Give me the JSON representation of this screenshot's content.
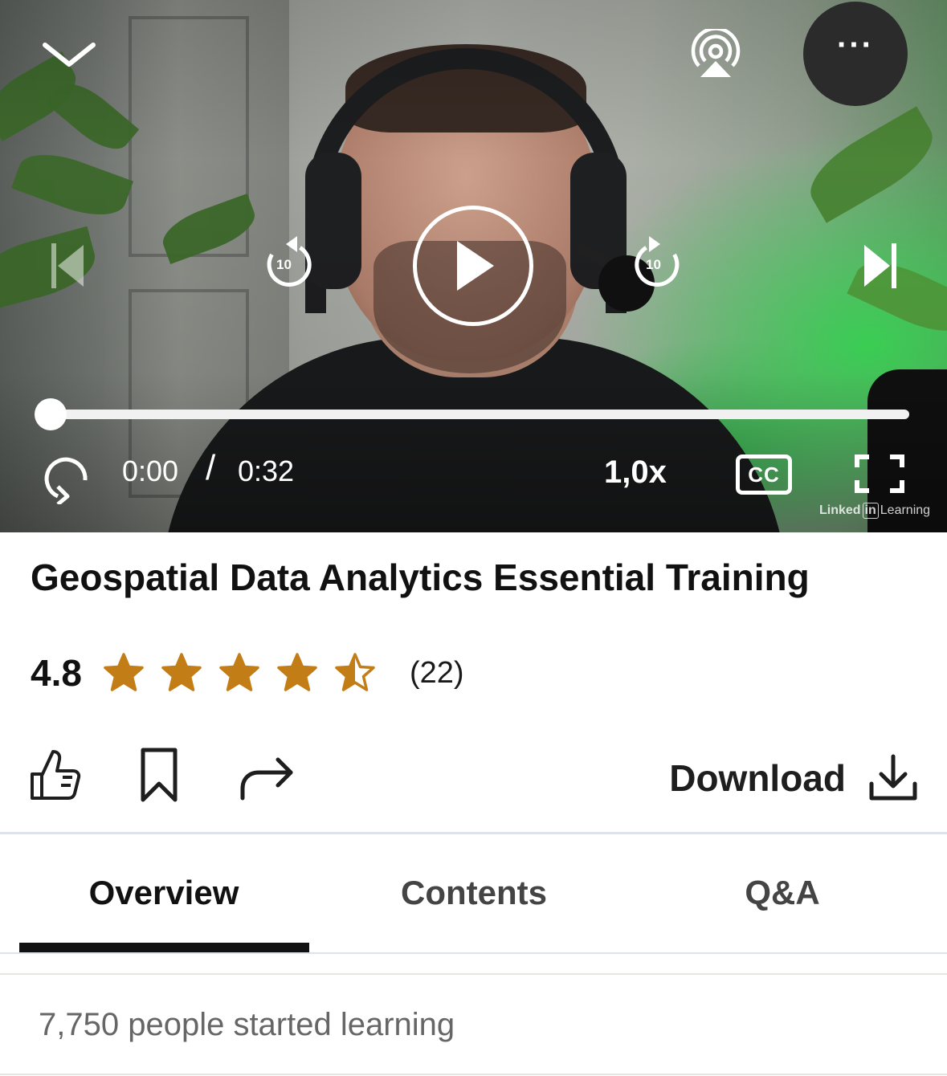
{
  "player": {
    "current_time": "0:00",
    "separator": "/",
    "duration": "0:32",
    "progress": 0.0,
    "speed": "1,0x",
    "cc_label": "CC",
    "seek_back_seconds": "10",
    "seek_forward_seconds": "10",
    "more_label": "···",
    "watermark": {
      "brand_a": "Linked",
      "brand_in": "in",
      "brand_b": "Learning"
    }
  },
  "course": {
    "title": "Geospatial Data Analytics Essential Training",
    "rating": "4.8",
    "rating_stars": 4.5,
    "rating_count": "(22)",
    "learners": "7,750 people started learning"
  },
  "actions": {
    "download_label": "Download"
  },
  "tabs": [
    {
      "label": "Overview",
      "active": true
    },
    {
      "label": "Contents",
      "active": false
    },
    {
      "label": "Q&A",
      "active": false
    }
  ],
  "colors": {
    "star": "#C37D16",
    "text_primary": "#111111",
    "text_secondary": "#666666",
    "tab_active_underline": "#111111"
  },
  "icons": {
    "collapse": "chevron-down-icon",
    "airplay": "airplay-icon",
    "more": "more-icon",
    "previous": "skip-previous-icon",
    "rewind": "rewind-10-icon",
    "play": "play-icon",
    "forward": "forward-10-icon",
    "next": "skip-next-icon",
    "loop": "loop-icon",
    "captions": "closed-captions-icon",
    "fullscreen": "fullscreen-icon",
    "like": "thumbs-up-icon",
    "save": "bookmark-icon",
    "share": "share-icon",
    "download": "download-icon"
  }
}
